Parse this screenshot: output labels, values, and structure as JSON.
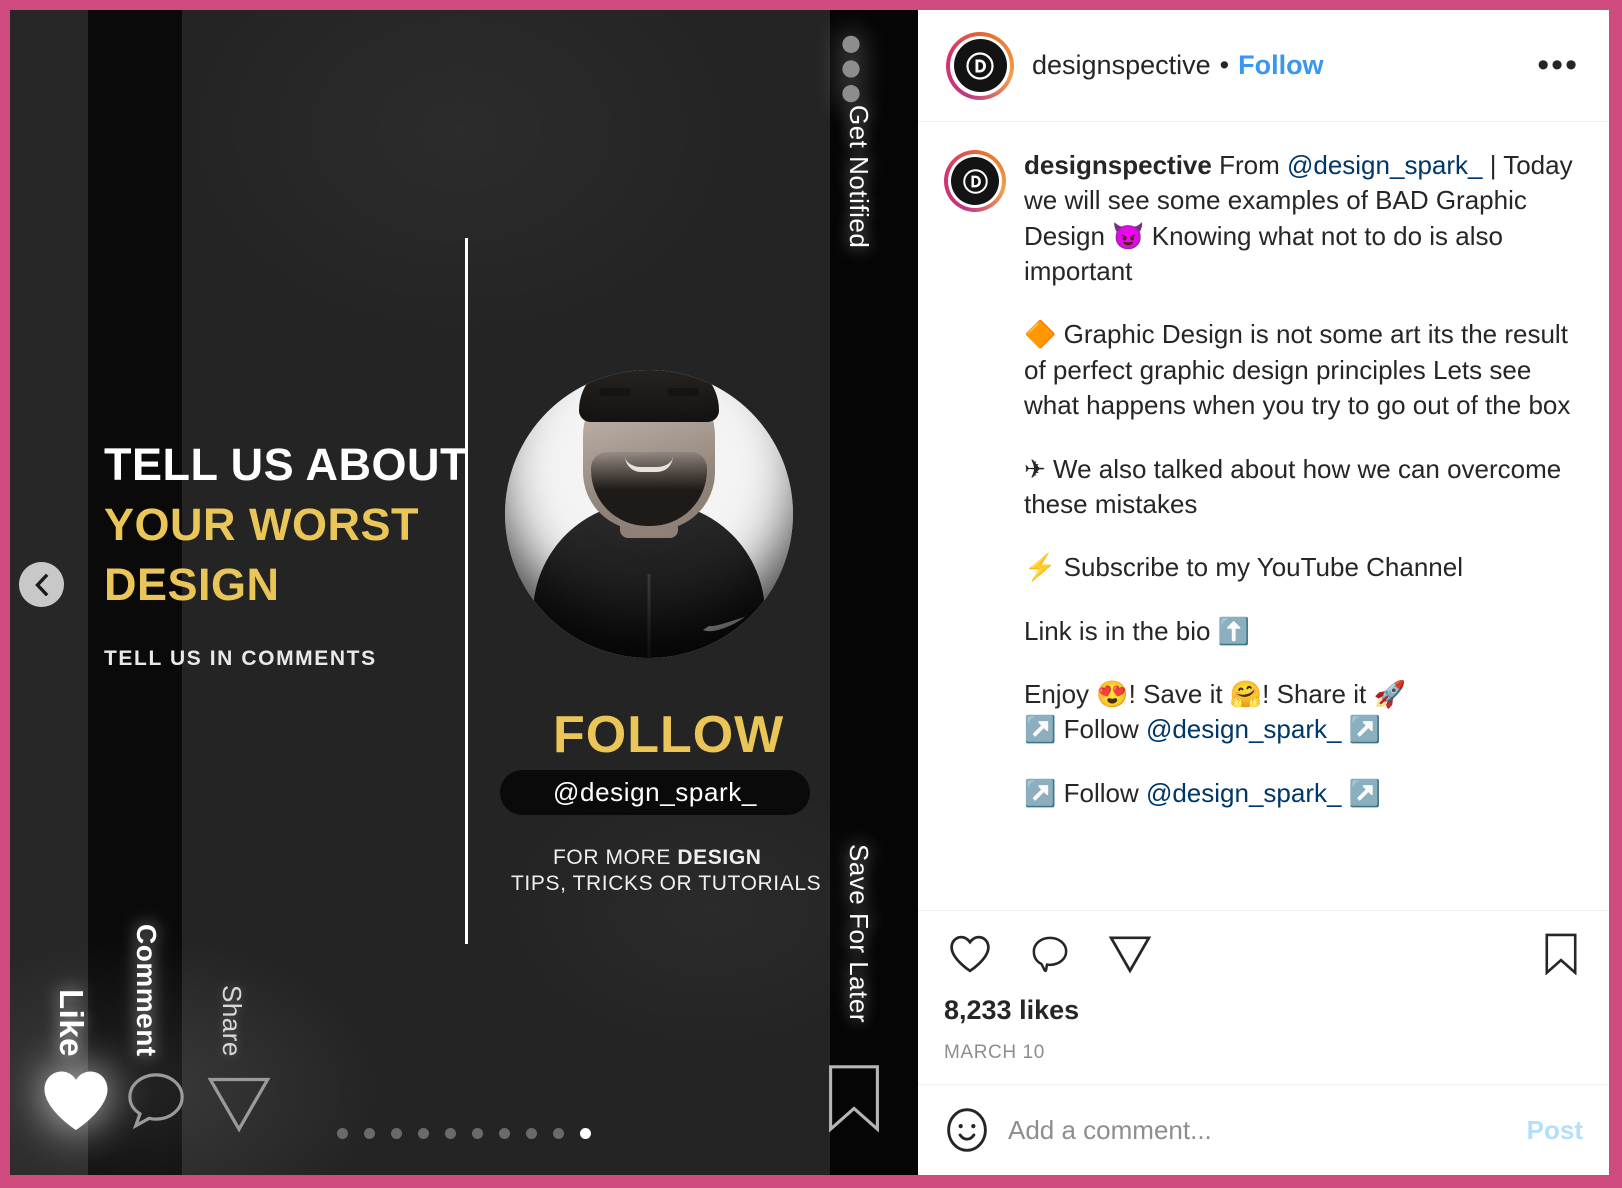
{
  "theme": {
    "frame_color": "#cf4a7e",
    "accent_blue": "#3897f0",
    "mention_blue": "#00376b",
    "gold": "#e9c657",
    "text_dark": "#262626",
    "muted": "#8e8e8e"
  },
  "header": {
    "username": "designspective",
    "separator": "•",
    "follow_label": "Follow",
    "more_label": "•••",
    "avatar_letter": "D"
  },
  "caption": {
    "username": "designspective",
    "paragraphs": [
      {
        "lead": "From ",
        "mention": "@design_spark_",
        "rest": " | Today we will see some examples of BAD Graphic Design 😈 Knowing what not to do is also important"
      },
      {
        "text": "🔶 Graphic Design is not some art its the result of perfect graphic design principles Lets see what happens when you try to go out of the box"
      },
      {
        "text": "✈ We also talked about how we can overcome these mistakes"
      },
      {
        "text": "⚡ Subscribe to my YouTube Channel"
      },
      {
        "text": "Link is in the bio ⬆️"
      },
      {
        "lead": "Enjoy 😍! Save it 🤗! Share it 🚀\n↗️ Follow ",
        "mention": "@design_spark_",
        "rest": " ↗️"
      },
      {
        "lead": "↗️ Follow ",
        "mention": "@design_spark_",
        "rest": " ↗️"
      }
    ]
  },
  "actions": {
    "like_icon": "heart-icon",
    "comment_icon": "comment-icon",
    "share_icon": "share-icon",
    "save_icon": "bookmark-icon",
    "likes_count": "8,233 likes",
    "date": "MARCH 10"
  },
  "comment_bar": {
    "emoji_icon": "emoji-smiley-icon",
    "placeholder": "Add a comment...",
    "value": "",
    "post_label": "Post"
  },
  "media": {
    "prev_icon": "chevron-left-icon",
    "headline": {
      "line1": "TELL US ABOUT",
      "line2": "YOUR WORST",
      "line3": "DESIGN",
      "subtitle": "TELL US IN COMMENTS"
    },
    "follow_block": {
      "title": "FOLLOW",
      "handle": "@design_spark_",
      "more_line1_prefix": "FOR MORE ",
      "more_line1_bold": "DESIGN",
      "more_line2": "TIPS, TRICKS OR TUTORIALS"
    },
    "side_labels": {
      "like": "Like",
      "comment": "Comment",
      "share": "Share",
      "get_notified": "Get Notified",
      "save_for_later": "Save For Later"
    },
    "carousel": {
      "total": 10,
      "active_index": 9
    }
  }
}
